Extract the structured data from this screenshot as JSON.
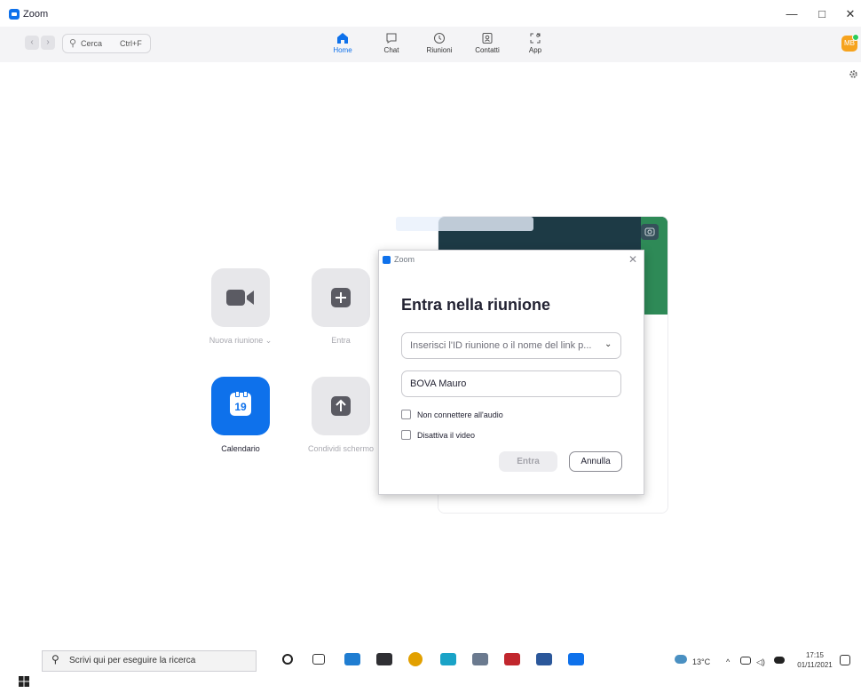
{
  "window": {
    "title": "Zoom",
    "minimize": "—",
    "maximize": "□",
    "close": "✕"
  },
  "toolbar": {
    "back": "‹",
    "forward": "›",
    "search_icon": "⚲",
    "search_label": "Cerca",
    "search_shortcut": "Ctrl+F",
    "tabs": [
      {
        "label": "Home",
        "icon": "home-icon",
        "active": true
      },
      {
        "label": "Chat",
        "icon": "chat-icon",
        "active": false
      },
      {
        "label": "Riunioni",
        "icon": "clock-icon",
        "active": false
      },
      {
        "label": "Contatti",
        "icon": "contacts-icon",
        "active": false
      },
      {
        "label": "App",
        "icon": "apps-icon",
        "active": false
      }
    ],
    "avatar_initials": "MB"
  },
  "home": {
    "tiles": [
      {
        "label": "Nuova riunione",
        "chevron": "⌄",
        "icon": "video-camera-icon"
      },
      {
        "label": "Entra",
        "icon": "plus-icon"
      },
      {
        "label": "Calendario",
        "icon": "calendar-icon",
        "day": "19"
      },
      {
        "label": "Condividi schermo",
        "icon": "share-up-arrow-icon"
      }
    ]
  },
  "dialog": {
    "window_title": "Zoom",
    "close": "✕",
    "heading": "Entra nella riunione",
    "meeting_id_placeholder": "Inserisci l'ID riunione o il nome del link p...",
    "dropdown_chevron": "⌄",
    "name_value": "BOVA Mauro",
    "options": [
      {
        "label": "Non connettere all'audio",
        "checked": false
      },
      {
        "label": "Disattiva il video",
        "checked": false
      }
    ],
    "join_button": "Entra",
    "cancel_button": "Annulla"
  },
  "taskbar": {
    "search_placeholder": "Scrivi qui per eseguire la ricerca",
    "temperature": "13°C",
    "tray_chevron": "^",
    "time": "17:15",
    "date": "01/11/2021"
  },
  "colors": {
    "accent": "#0E71EB",
    "avatar": "#F6A31E",
    "presence": "#2BCB5B"
  }
}
